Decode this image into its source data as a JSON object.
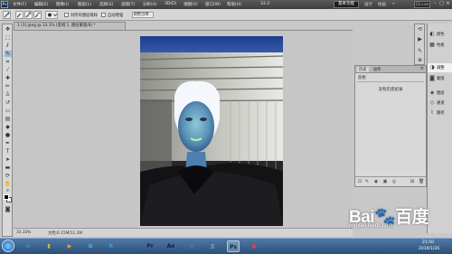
{
  "menubar": {
    "logo": "Ps",
    "items": [
      "文件(F)",
      "编辑(E)",
      "图像(I)",
      "图层(L)",
      "选择(S)",
      "滤镜(T)",
      "分析(A)",
      "3D(D)",
      "视图(V)",
      "窗口(W)",
      "帮助(H)"
    ],
    "zoom": "33.3",
    "workspace_active": "基本功能",
    "workspace_items": [
      "设计",
      "绘画",
      "»"
    ],
    "cs_live": "CS Live",
    "win_buttons": [
      "–",
      "□",
      "×"
    ]
  },
  "optbar": {
    "feather_label": "羽化:",
    "sample_all_label": "对所有图层取样",
    "auto_enhance_label": "自动增强",
    "refine_edge": "调整边缘..."
  },
  "document": {
    "tab_title": "1 (3).jpeg @ 33.3% (反相 1, 图层蒙版/8) *",
    "status_zoom": "33.33%",
    "status_doc": "文档:6.15M/11.2M"
  },
  "history": {
    "tabs": [
      "历史",
      "动作"
    ],
    "active_tab": "历史",
    "menu_icon": "≡",
    "snapshot_label": "反相",
    "message": "没有历史纪录"
  },
  "dock": {
    "items": [
      {
        "icon": "color-icon",
        "label": "颜色"
      },
      {
        "icon": "swatches-icon",
        "label": "色板"
      },
      {
        "icon": "adjustments-icon",
        "label": "调整"
      },
      {
        "icon": "masks-icon",
        "label": "蒙版"
      },
      {
        "icon": "layers-icon",
        "label": "图层"
      },
      {
        "icon": "channels-icon",
        "label": "通道"
      },
      {
        "icon": "paths-icon",
        "label": "路径"
      }
    ],
    "selected_index": 2
  },
  "taskbar": {
    "apps": [
      {
        "name": "ie-icon",
        "glyph": "e",
        "color": "#2a8ee0"
      },
      {
        "name": "folder-icon",
        "glyph": "▮",
        "color": "#e0b040"
      },
      {
        "name": "media-icon",
        "glyph": "▶",
        "color": "#ff9a2a"
      },
      {
        "name": "tool-icon",
        "glyph": "✿",
        "color": "#4fb8ff"
      },
      {
        "name": "k-icon",
        "glyph": "K",
        "color": "#2aa0ff"
      },
      {
        "name": "premiere-icon",
        "glyph": "Pr",
        "color": "#2a1a4a"
      },
      {
        "name": "aftereffects-icon",
        "glyph": "Ae",
        "color": "#1a1a4a"
      },
      {
        "name": "imagebrowser-icon",
        "glyph": "▦",
        "color": "#3a7ac0"
      },
      {
        "name": "file-icon",
        "glyph": "▯",
        "color": "#dddddd"
      },
      {
        "name": "photoshop-icon",
        "glyph": "Ps",
        "color": "#0b2a4a"
      },
      {
        "name": "qq-icon",
        "glyph": "●",
        "color": "#e04040"
      }
    ],
    "active_index": 9,
    "time": "21:50",
    "date": "2019/1/26"
  },
  "watermark": {
    "text": "Bai🐾百度",
    "sub": "jingyan.baidu.com"
  }
}
